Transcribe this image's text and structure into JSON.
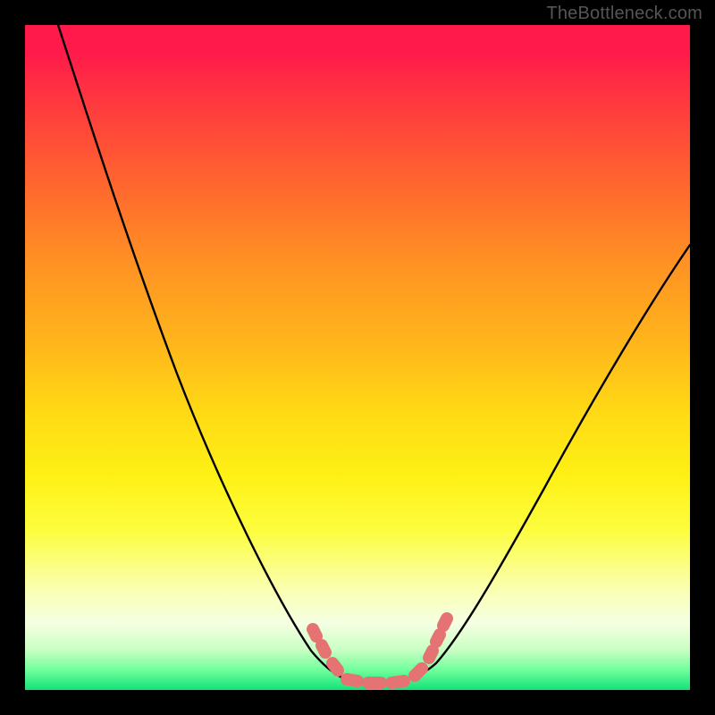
{
  "watermark": {
    "text": "TheBottleneck.com"
  },
  "colors": {
    "frame": "#000000",
    "curve": "#000000",
    "marker": "#e57373",
    "gradient_stops": [
      "#ff1a4b",
      "#ff3a3e",
      "#ff6a2d",
      "#ff8f24",
      "#ffb61b",
      "#ffd915",
      "#fef115",
      "#fdfd3f",
      "#faffb3",
      "#f5ffe2",
      "#c9ffc3",
      "#6fff9c",
      "#14e17a"
    ]
  },
  "chart_data": {
    "type": "line",
    "title": "",
    "xlabel": "",
    "ylabel": "",
    "xlim": [
      0,
      100
    ],
    "ylim": [
      0,
      100
    ],
    "grid": false,
    "legend": false,
    "series": [
      {
        "name": "bottleneck-curve",
        "x": [
          5,
          10,
          15,
          20,
          25,
          30,
          35,
          40,
          43,
          46,
          48,
          50,
          52,
          54,
          56,
          58,
          60,
          62,
          66,
          70,
          75,
          80,
          85,
          90,
          95,
          100
        ],
        "y": [
          100,
          88,
          76,
          64,
          53,
          42,
          32,
          22,
          15,
          9,
          5,
          3,
          2,
          2,
          2,
          2,
          3,
          5,
          10,
          17,
          25,
          34,
          43,
          52,
          60,
          67
        ]
      }
    ],
    "markers": {
      "name": "valley-markers",
      "x": [
        44,
        47,
        49,
        51,
        53,
        55,
        58,
        60,
        61,
        62
      ],
      "y": [
        11,
        6,
        3,
        2,
        2,
        2,
        3,
        5,
        7,
        10
      ]
    },
    "annotations": []
  }
}
